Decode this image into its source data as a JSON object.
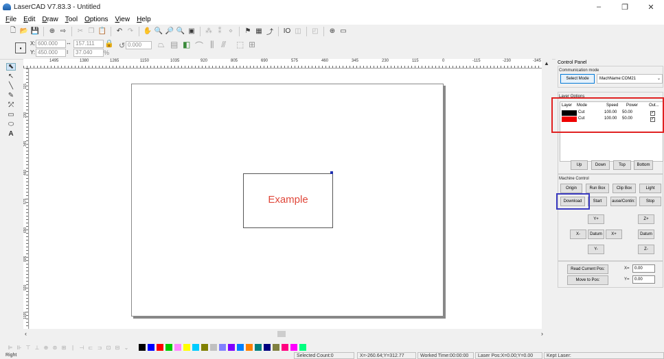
{
  "window": {
    "title": "LaserCAD V7.83.3 - Untitled",
    "min": "–",
    "max": "❐",
    "close": "✕"
  },
  "menu": [
    "File",
    "Edit",
    "Draw",
    "Tool",
    "Options",
    "View",
    "Help"
  ],
  "coords": {
    "x_label": "X:",
    "x_value": "600.000",
    "y_label": "Y:",
    "y_value": "450.000",
    "w_value": "157.111",
    "h_value": "37.040",
    "pct": "%",
    "angle_value": "0.000"
  },
  "ruler": {
    "h_ticks": [
      "1495",
      "1380",
      "1265",
      "1150",
      "1035",
      "920",
      "805",
      "690",
      "575",
      "460",
      "345",
      "230",
      "115",
      "0",
      "-115",
      "-230",
      "-345"
    ],
    "v_ticks": [
      "115",
      "230",
      "345",
      "460",
      "575",
      "690",
      "805",
      "920",
      "1035"
    ]
  },
  "canvas": {
    "example_text": "Example"
  },
  "panel": {
    "title": "Control Panel",
    "comm_label": "Communication mode",
    "select_mode": "Select Mode",
    "machine_name": "MachName:COM21",
    "layer_options": "Layer Options",
    "table_headers": [
      "Layer",
      "Mode",
      "Speed",
      "Power",
      "Out..."
    ],
    "layers": [
      {
        "color": "#000000",
        "mode": "Cut",
        "speed": "100.00",
        "power": "50.00",
        "out": "✓"
      },
      {
        "color": "#ee0000",
        "mode": "Cut",
        "speed": "100.00",
        "power": "50.00",
        "out": "✓"
      }
    ],
    "order_buttons": [
      "Up",
      "Down",
      "Top",
      "Bottom"
    ],
    "machine_control": "Machine Control",
    "mc_row1": [
      "Origin",
      "Run Box",
      "Clip Box",
      "Light"
    ],
    "mc_row2": [
      "Download",
      "Start",
      "ause/Contin:",
      "Stop"
    ],
    "jog": {
      "yplus": "Y+",
      "xminus": "X-",
      "datum": "Datum",
      "xplus": "X+",
      "yminus": "Y-",
      "zplus": "Z+",
      "zdatum": "Datum",
      "zminus": "Z-"
    },
    "read_pos": "Read Current Pos:",
    "move_pos": "Move to Pos:",
    "x_lbl": "X=",
    "y_lbl": "Y=",
    "x_val": "0.00",
    "y_val": "0.00"
  },
  "palette": [
    "#000000",
    "#0000ff",
    "#ff0000",
    "#00cc00",
    "#ff88ff",
    "#ffff00",
    "#00ccff",
    "#808000",
    "#c0c0c0",
    "#8080ff",
    "#8000ff",
    "#0080ff",
    "#ff8000",
    "#008080",
    "#000080",
    "#808040",
    "#ff0080",
    "#ff00ff",
    "#00ff80"
  ],
  "status": {
    "left": "Right",
    "selected": "Selected Count:0",
    "pos": "X=-260.64;Y=312.77",
    "worked": "Worked Time:00:00:00",
    "laser_pos": "Laser Pos:X=0.00;Y=0.00",
    "kept": "Kept Laser:"
  }
}
